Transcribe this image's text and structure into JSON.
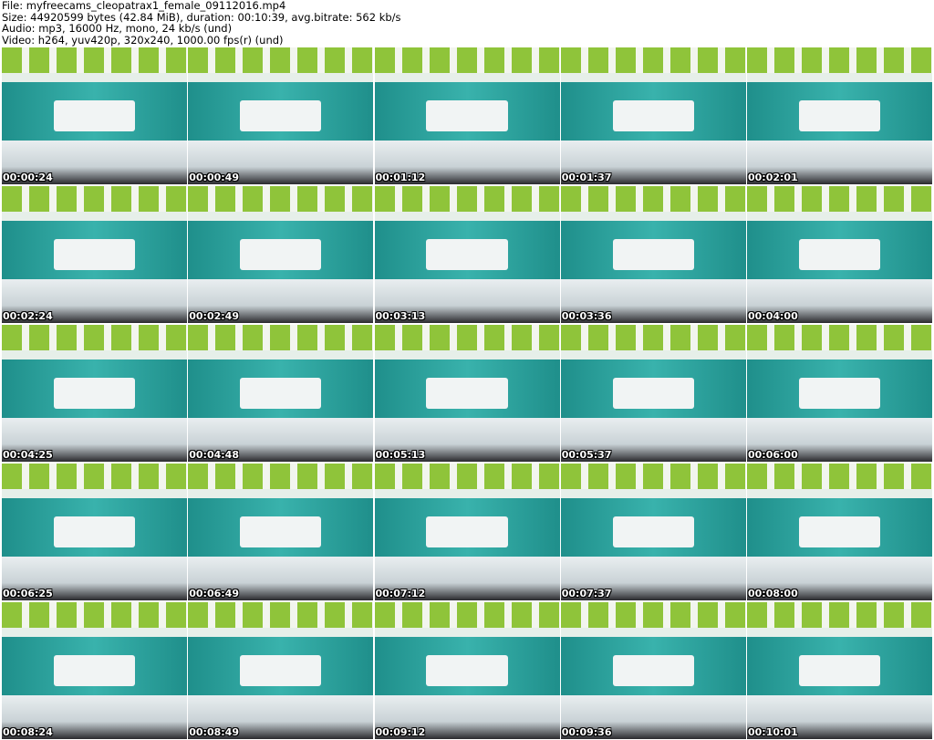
{
  "header": {
    "file": "File: myfreecams_cleopatrax1_female_09112016.mp4",
    "size": "Size: 44920599 bytes (42.84 MiB), duration: 00:10:39, avg.bitrate: 562 kb/s",
    "audio": "Audio: mp3, 16000 Hz, mono, 24 kb/s (und)",
    "video": "Video: h264, yuv420p, 320x240, 1000.00 fps(r) (und)"
  },
  "timestamps": [
    "00:00:24",
    "00:00:49",
    "00:01:12",
    "00:01:37",
    "00:02:01",
    "00:02:24",
    "00:02:49",
    "00:03:13",
    "00:03:36",
    "00:04:00",
    "00:04:25",
    "00:04:48",
    "00:05:13",
    "00:05:37",
    "00:06:00",
    "00:06:25",
    "00:06:49",
    "00:07:12",
    "00:07:37",
    "00:08:00",
    "00:08:24",
    "00:08:49",
    "00:09:12",
    "00:09:36",
    "00:10:01"
  ]
}
